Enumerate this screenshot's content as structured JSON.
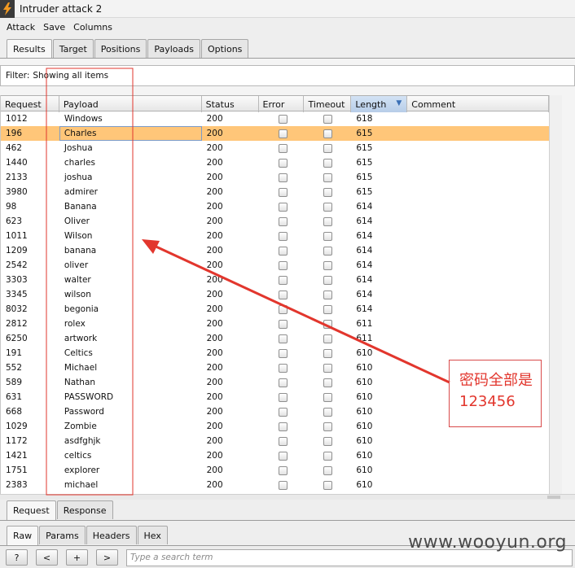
{
  "window": {
    "title": "Intruder attack 2",
    "icon": "burp-lightning-icon"
  },
  "menu": [
    "Attack",
    "Save",
    "Columns"
  ],
  "tabs": [
    {
      "label": "Results",
      "active": true
    },
    {
      "label": "Target",
      "active": false
    },
    {
      "label": "Positions",
      "active": false
    },
    {
      "label": "Payloads",
      "active": false
    },
    {
      "label": "Options",
      "active": false
    }
  ],
  "filter": {
    "label": "Filter:",
    "value": "Showing all items"
  },
  "table": {
    "columns": [
      "Request",
      "Payload",
      "Status",
      "Error",
      "Timeout",
      "Length",
      "Comment"
    ],
    "sorted_column": "Length",
    "sort_direction": "descending",
    "selected_row": 1,
    "rows": [
      {
        "request": "1012",
        "payload": "Windows",
        "status": "200",
        "length": "618"
      },
      {
        "request": "196",
        "payload": "Charles",
        "status": "200",
        "length": "615"
      },
      {
        "request": "462",
        "payload": "Joshua",
        "status": "200",
        "length": "615"
      },
      {
        "request": "1440",
        "payload": "charles",
        "status": "200",
        "length": "615"
      },
      {
        "request": "2133",
        "payload": "joshua",
        "status": "200",
        "length": "615"
      },
      {
        "request": "3980",
        "payload": "admirer",
        "status": "200",
        "length": "615"
      },
      {
        "request": "98",
        "payload": "Banana",
        "status": "200",
        "length": "614"
      },
      {
        "request": "623",
        "payload": "Oliver",
        "status": "200",
        "length": "614"
      },
      {
        "request": "1011",
        "payload": "Wilson",
        "status": "200",
        "length": "614"
      },
      {
        "request": "1209",
        "payload": "banana",
        "status": "200",
        "length": "614"
      },
      {
        "request": "2542",
        "payload": "oliver",
        "status": "200",
        "length": "614"
      },
      {
        "request": "3303",
        "payload": "walter",
        "status": "200",
        "length": "614"
      },
      {
        "request": "3345",
        "payload": "wilson",
        "status": "200",
        "length": "614"
      },
      {
        "request": "8032",
        "payload": "begonia",
        "status": "200",
        "length": "614"
      },
      {
        "request": "2812",
        "payload": "rolex",
        "status": "200",
        "length": "611"
      },
      {
        "request": "6250",
        "payload": "artwork",
        "status": "200",
        "length": "611"
      },
      {
        "request": "191",
        "payload": "Celtics",
        "status": "200",
        "length": "610"
      },
      {
        "request": "552",
        "payload": "Michael",
        "status": "200",
        "length": "610"
      },
      {
        "request": "589",
        "payload": "Nathan",
        "status": "200",
        "length": "610"
      },
      {
        "request": "631",
        "payload": "PASSWORD",
        "status": "200",
        "length": "610"
      },
      {
        "request": "668",
        "payload": "Password",
        "status": "200",
        "length": "610"
      },
      {
        "request": "1029",
        "payload": "Zombie",
        "status": "200",
        "length": "610"
      },
      {
        "request": "1172",
        "payload": "asdfghjk",
        "status": "200",
        "length": "610"
      },
      {
        "request": "1421",
        "payload": "celtics",
        "status": "200",
        "length": "610"
      },
      {
        "request": "1751",
        "payload": "explorer",
        "status": "200",
        "length": "610"
      },
      {
        "request": "2383",
        "payload": "michael",
        "status": "200",
        "length": "610"
      }
    ]
  },
  "request_tabs": [
    {
      "label": "Request",
      "active": true
    },
    {
      "label": "Response",
      "active": false
    }
  ],
  "view_tabs": [
    {
      "label": "Raw",
      "active": true
    },
    {
      "label": "Params",
      "active": false
    },
    {
      "label": "Headers",
      "active": false
    },
    {
      "label": "Hex",
      "active": false
    }
  ],
  "bottom": {
    "help_label": "?",
    "prev_label": "<",
    "add_label": "+",
    "next_label": ">",
    "search_placeholder": "Type a search term"
  },
  "annotation": {
    "line1": "密码全部是",
    "line2": "123456",
    "color": "#e2362d"
  },
  "watermark": "www.wooyun.org",
  "colors": {
    "selected_row": "#ffc679",
    "annotation": "#e2362d",
    "sorted_header": "#b7cde8"
  }
}
